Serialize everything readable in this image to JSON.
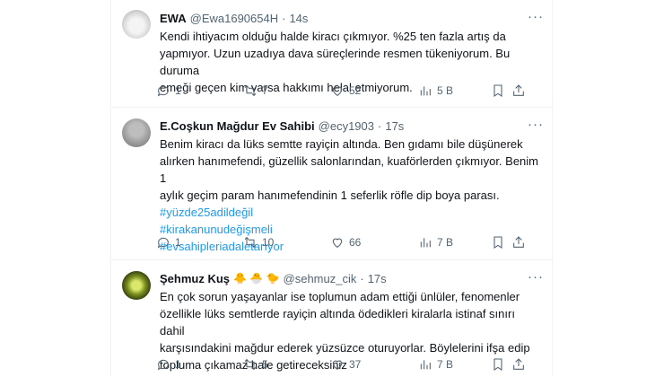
{
  "tweets": [
    {
      "name": "EWA",
      "handle": "@Ewa1690654H",
      "time": "14s",
      "emoji": "",
      "text_lines": [
        "Kendi ihtiyacım olduğu halde kiracı çıkmıyor. %25 ten fazla artış da",
        "yapmıyor. Uzun uzadıya dava süreçlerinde resmen tükeniyorum. Bu duruma",
        "emeği geçen kim varsa hakkımı helal etmiyorum."
      ],
      "hashtags": [],
      "replies": "1",
      "retweets": "7",
      "likes": "52",
      "views": "5 B"
    },
    {
      "name": "E.Coşkun Mağdur Ev Sahibi",
      "handle": "@ecy1903",
      "time": "17s",
      "emoji": "",
      "text_lines": [
        "Benim kiracı da lüks semtte rayiçin altında. Ben gıdamı bile düşünerek",
        "alırken hanımefendi, güzellik salonlarından, kuaförlerden çıkmıyor. Benim 1",
        "aylık geçim param hanımefendinin 1 seferlik röfle dip boya parası."
      ],
      "hashtags": [
        "#yüzde25adildeğil",
        "#kirakanunudeğişmeli",
        "#evsahipleriadaletarıyor"
      ],
      "replies": "1",
      "retweets": "10",
      "likes": "66",
      "views": "7 B"
    },
    {
      "name": "Şehmuz Kuş",
      "handle": "@sehmuz_cik",
      "time": "17s",
      "emoji": "🐥 🐣 🐤",
      "text_lines": [
        "En çok sorun yaşayanlar ise toplumun adam ettiği ünlüler, fenomenler",
        "özellikle lüks semtlerde rayiçin altında ödedikleri kiralarla istinaf sınırı dahil",
        "karşısındakini mağdur ederek yüzsüzce oturuyorlar. Böylelerini ifşa edip",
        "topluma çıkamaz hale getireceksiniz"
      ],
      "hashtags": [],
      "replies": "1",
      "retweets": "5",
      "likes": "37",
      "views": "7 B"
    }
  ],
  "icons": {
    "reply": "reply-icon",
    "retweet": "retweet-icon",
    "like": "heart-icon",
    "views": "views-icon",
    "bookmark": "bookmark-icon",
    "share": "share-icon",
    "more": "more-icon"
  },
  "colors": {
    "text": "#0f1419",
    "secondary": "#536471",
    "link": "#1d9bf0",
    "divider": "#eff3f4"
  }
}
